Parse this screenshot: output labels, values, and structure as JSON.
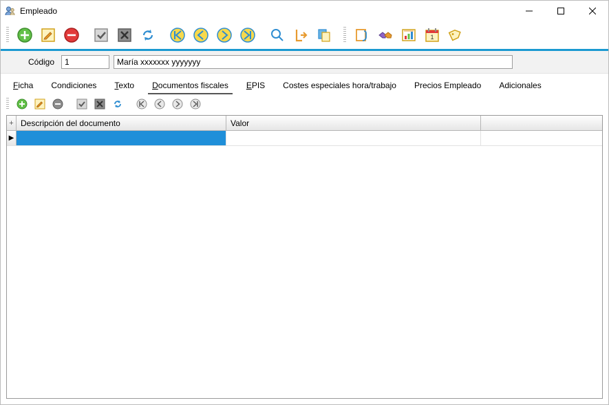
{
  "window": {
    "title": "Empleado"
  },
  "codigo": {
    "label": "Código",
    "value": "1",
    "name": "María xxxxxxx yyyyyyy"
  },
  "tabs": [
    {
      "label": "Ficha",
      "accel": "F"
    },
    {
      "label": "Condiciones"
    },
    {
      "label": "Texto",
      "accel": "T"
    },
    {
      "label": "Documentos fiscales",
      "accel": "D",
      "active": true
    },
    {
      "label": "EPIS",
      "accel": "E"
    },
    {
      "label": "Costes especiales hora/trabajo"
    },
    {
      "label": "Precios Empleado"
    },
    {
      "label": "Adicionales"
    }
  ],
  "grid": {
    "columns": [
      "Descripción del documento",
      "Valor"
    ],
    "rows": [
      {
        "descripcion": "",
        "valor": "",
        "selected": true
      }
    ]
  },
  "colors": {
    "green": "#62c048",
    "greenDark": "#3e8d2d",
    "yellow": "#f7d94c",
    "yellowStroke": "#d1a21a",
    "red": "#e23a3a",
    "redDark": "#a81e1e",
    "grey": "#8d8d8d",
    "greyDark": "#5b5b5b",
    "blue": "#2e8dd1",
    "navBlue": "#2e8dd1",
    "orange": "#e79a2f",
    "purple": "#8e63c8"
  }
}
